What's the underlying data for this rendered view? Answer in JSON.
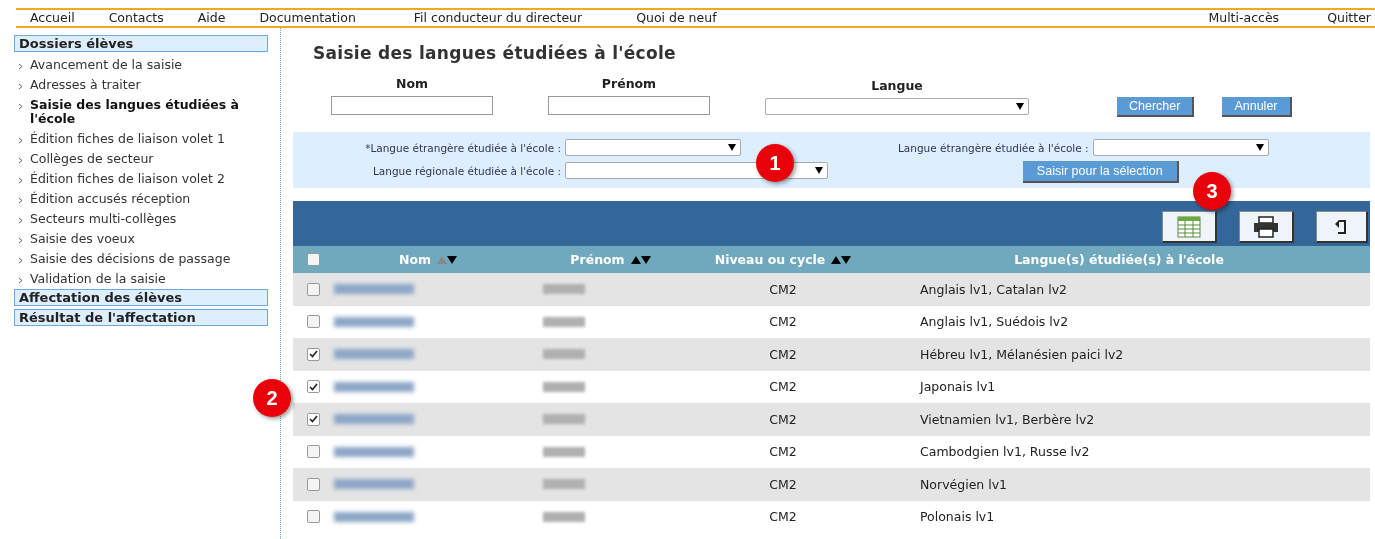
{
  "nav": {
    "left": [
      "Accueil",
      "Contacts",
      "Aide",
      "Documentation",
      "Fil conducteur du directeur",
      "Quoi de neuf"
    ],
    "right": [
      "Multi-accès",
      "Quitter"
    ]
  },
  "sidebar": {
    "sections": [
      {
        "title": "Dossiers élèves",
        "items": [
          {
            "label": "Avancement de la saisie",
            "selected": false
          },
          {
            "label": "Adresses à traiter",
            "selected": false
          },
          {
            "label": "Saisie des langues étudiées à l'école",
            "selected": true
          },
          {
            "label": "Édition fiches de liaison volet 1",
            "selected": false
          },
          {
            "label": "Collèges de secteur",
            "selected": false
          },
          {
            "label": "Édition fiches de liaison volet 2",
            "selected": false
          },
          {
            "label": "Édition accusés réception",
            "selected": false
          },
          {
            "label": "Secteurs multi-collèges",
            "selected": false
          },
          {
            "label": "Saisie des voeux",
            "selected": false
          },
          {
            "label": "Saisie des décisions de passage",
            "selected": false
          },
          {
            "label": "Validation de la saisie",
            "selected": false
          }
        ]
      },
      {
        "title": "Affectation des élèves"
      },
      {
        "title": "Résultat de l'affectation"
      }
    ]
  },
  "page_title": "Saisie des langues étudiées à l'école",
  "search": {
    "fields": [
      {
        "label": "Nom",
        "kind": "text"
      },
      {
        "label": "Prénom",
        "kind": "text"
      },
      {
        "label": "Langue",
        "kind": "select"
      }
    ],
    "buttons": [
      "Chercher",
      "Annuler"
    ]
  },
  "selection_panel": {
    "fields": [
      {
        "label": "*Langue étrangère étudiée à l'école :"
      },
      {
        "label": "Langue régionale étudiée à l'école :"
      },
      {
        "label": "Langue étrangère étudiée à l'école :"
      }
    ],
    "button": "Saisir pour la sélection"
  },
  "table": {
    "select_all_checked": false,
    "columns": [
      {
        "label": "Nom",
        "kind": "sorted"
      },
      {
        "label": "Prénom",
        "kind": "sortable"
      },
      {
        "label": "Niveau ou cycle",
        "kind": "sortable"
      },
      {
        "label": "Langue(s) étudiée(s) à l'école",
        "kind": "plain"
      }
    ],
    "rows": [
      {
        "checked": false,
        "level_text": "CM2",
        "languages": "Anglais lv1, Catalan lv2"
      },
      {
        "checked": false,
        "level_text": "CM2",
        "languages": "Anglais lv1, Suédois lv2"
      },
      {
        "checked": true,
        "level_text": "CM2",
        "languages": "Hébreu lv1, Mélanésien paici lv2"
      },
      {
        "checked": true,
        "level_text": "CM2",
        "languages": "Japonais lv1"
      },
      {
        "checked": true,
        "level_text": "CM2",
        "languages": "Vietnamien lv1, Berbère lv2"
      },
      {
        "checked": false,
        "level_text": "CM2",
        "languages": "Cambodgien lv1, Russe lv2"
      },
      {
        "checked": false,
        "level_text": "CM2",
        "languages": "Norvégien lv1"
      },
      {
        "checked": false,
        "level_text": "CM2",
        "languages": "Polonais lv1"
      }
    ]
  },
  "callouts": [
    "1",
    "2",
    "3"
  ]
}
